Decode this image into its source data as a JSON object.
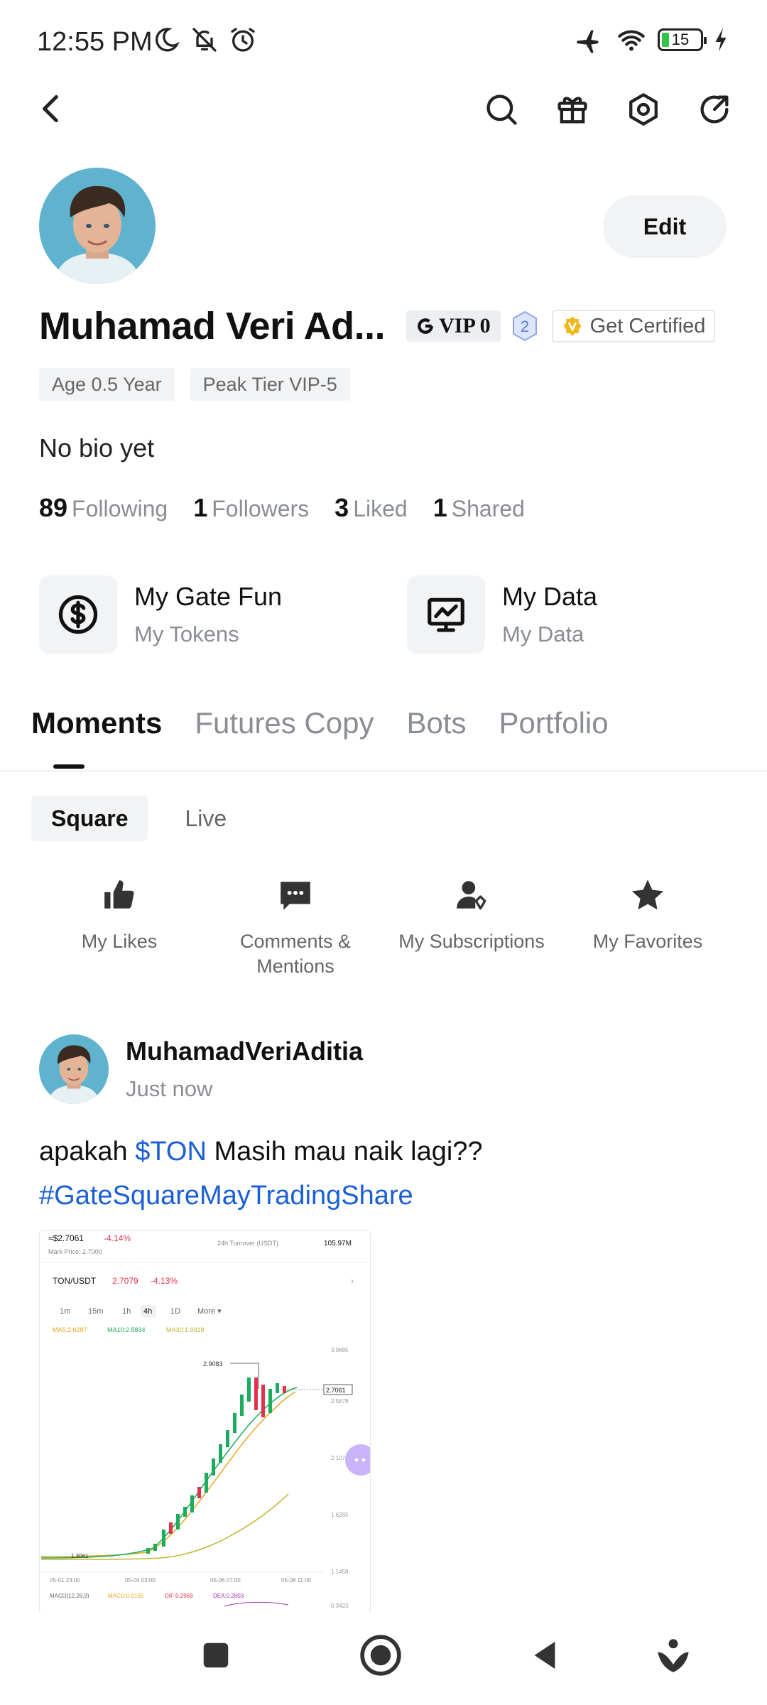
{
  "status_bar": {
    "time": "12:55 PM",
    "battery": "15",
    "left_icons": [
      "moon-icon",
      "bell-off-icon",
      "alarm-icon"
    ],
    "right_icons": [
      "airplane-icon",
      "wifi-icon",
      "battery-icon",
      "charging-icon"
    ]
  },
  "header": {
    "actions": [
      "search-icon",
      "gift-icon",
      "settings-icon",
      "share-icon"
    ]
  },
  "profile": {
    "name": "Muhamad Veri Ad...",
    "edit_label": "Edit",
    "vip": "VIP 0",
    "level": "2",
    "certify": "Get Certified",
    "tags": [
      "Age 0.5 Year",
      "Peak Tier VIP-5"
    ],
    "bio": "No bio yet",
    "stats": [
      {
        "num": "89",
        "label": "Following"
      },
      {
        "num": "1",
        "label": "Followers"
      },
      {
        "num": "3",
        "label": "Liked"
      },
      {
        "num": "1",
        "label": "Shared"
      }
    ]
  },
  "shortcuts": [
    {
      "title": "My Gate Fun",
      "sub": "My Tokens",
      "icon": "dollar-icon"
    },
    {
      "title": "My Data",
      "sub": "My Data",
      "icon": "monitor-chart-icon"
    }
  ],
  "tabs": [
    "Moments",
    "Futures Copy",
    "Bots",
    "Portfolio"
  ],
  "subtabs": [
    "Square",
    "Live"
  ],
  "quick_actions": [
    {
      "label": "My Likes",
      "icon": "thumb-up-icon"
    },
    {
      "label": "Comments &\nMentions",
      "icon": "comment-icon"
    },
    {
      "label": "My Subscriptions",
      "icon": "subscription-icon"
    },
    {
      "label": "My Favorites",
      "icon": "star-icon"
    }
  ],
  "post": {
    "author": "MuhamadVeriAditia",
    "time": "Just now",
    "text_before": "apakah ",
    "ticker": "$TON",
    "text_after": " Masih mau naik lagi??",
    "hashtag": "#GateSquareMayTradingShare",
    "image": {
      "price": "≈$2.7061",
      "change": "-4.14%",
      "mark": "Mark Price: 2.7000",
      "turnover_label": "24h   Turnover (USDT)",
      "turnover_value": "105.97M",
      "pair": "TON/USDT",
      "pair_price": "2.7079",
      "pair_change": "-4.13%",
      "intervals": [
        "1m",
        "15m",
        "1h",
        "4h",
        "1D",
        "More ▾"
      ],
      "ma": [
        "MA5:2.6287",
        "MA10:2.5834",
        "MA30:1.9918"
      ],
      "high": "2.9083",
      "low": "1.3061",
      "last": "2.7061",
      "axis": [
        "3.0685",
        "2.5878",
        "2.107",
        "1.6265",
        "1.1458",
        "0.3423"
      ],
      "dates": [
        "05-01 23:00",
        "05-04 03:00",
        "05-06 07:00",
        "05-08 11:00"
      ],
      "macd": [
        "MACD(12,26,9)",
        "MACD:0.0165",
        "DIF:0.2969",
        "DEA:0.2803"
      ]
    }
  },
  "system_nav": [
    "square-icon",
    "home-circle-icon",
    "back-triangle-icon",
    "assistant-icon"
  ]
}
